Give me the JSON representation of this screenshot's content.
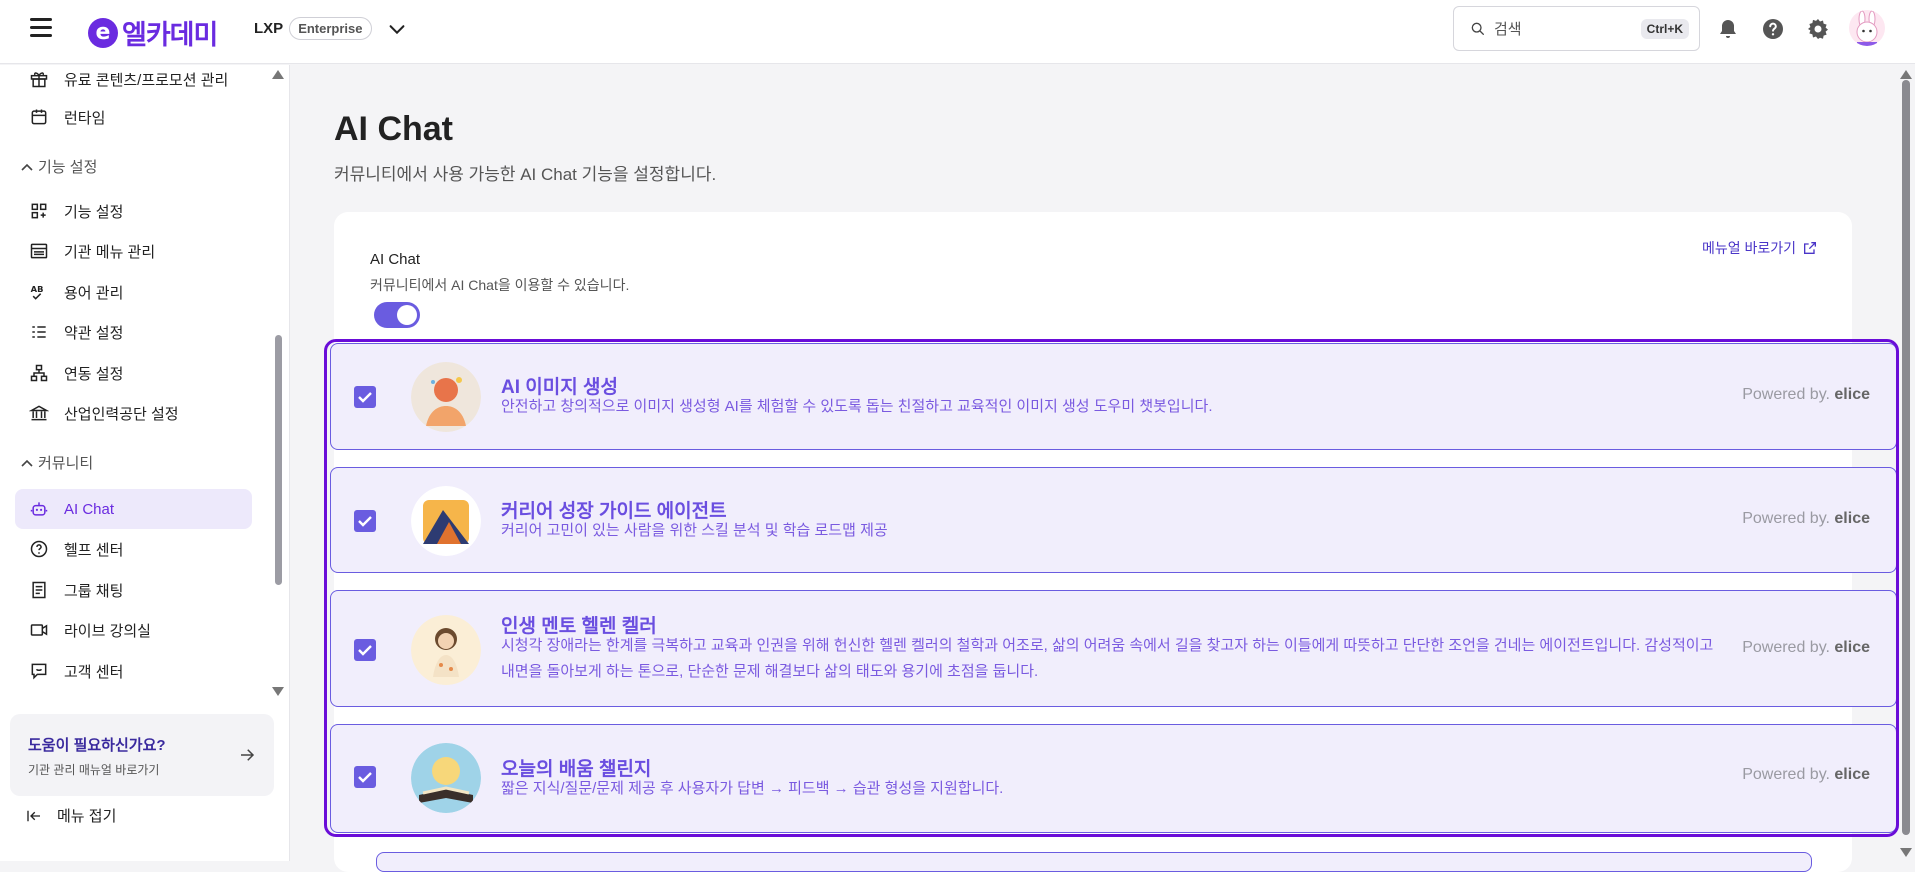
{
  "header": {
    "logo_text": "엘카데미",
    "product": "LXP",
    "edition": "Enterprise",
    "search_placeholder": "검색",
    "search_shortcut": "Ctrl+K"
  },
  "sidebar": {
    "items_top": [
      {
        "label": "유료 콘텐츠/프로모션 관리",
        "icon": "gift-icon"
      },
      {
        "label": "런타임",
        "icon": "calendar-icon"
      }
    ],
    "section_features": "기능 설정",
    "features_items": [
      {
        "label": "기능 설정",
        "icon": "grid-plus-icon"
      },
      {
        "label": "기관 메뉴 관리",
        "icon": "menu-panel-icon"
      },
      {
        "label": "용어 관리",
        "icon": "spellcheck-icon"
      },
      {
        "label": "약관 설정",
        "icon": "list-icon"
      },
      {
        "label": "연동 설정",
        "icon": "hierarchy-icon"
      },
      {
        "label": "산업인력공단 설정",
        "icon": "bank-icon"
      }
    ],
    "section_community": "커뮤니티",
    "community_items": [
      {
        "label": "AI Chat",
        "icon": "robot-icon"
      },
      {
        "label": "헬프 센터",
        "icon": "help-icon"
      },
      {
        "label": "그룹 채팅",
        "icon": "chat-doc-icon"
      },
      {
        "label": "라이브 강의실",
        "icon": "video-icon"
      },
      {
        "label": "고객 센터",
        "icon": "support-icon"
      }
    ],
    "help_title": "도움이 필요하신가요?",
    "help_sub": "기관 관리 매뉴얼 바로가기",
    "collapse_label": "메뉴 접기"
  },
  "main": {
    "title": "AI Chat",
    "description": "커뮤니티에서 사용 가능한 AI Chat 기능을 설정합니다.",
    "feature_label": "AI Chat",
    "feature_desc": "커뮤니티에서 AI Chat을 이용할 수 있습니다.",
    "toggle_on": true,
    "manual_link": "메뉴얼 바로가기",
    "powered_prefix": "Powered by.",
    "powered_brand": "elice",
    "bots": [
      {
        "name": "AI 이미지 생성",
        "desc": "안전하고 창의적으로 이미지 생성형 AI를 체험할 수 있도록 돕는 친절하고 교육적인 이미지 생성 도우미 챗봇입니다.",
        "checked": true
      },
      {
        "name": "커리어 성장 가이드 에이전트",
        "desc": "커리어 고민이 있는 사람을 위한 스킬 분석 및 학습 로드맵 제공",
        "checked": true
      },
      {
        "name": "인생 멘토 헬렌 켈러",
        "desc": "시청각 장애라는 한계를 극복하고 교육과 인권을 위해 헌신한 헬렌 켈러의 철학과 어조로, 삶의 어려움 속에서 길을 찾고자 하는 이들에게 따뜻하고 단단한 조언을 건네는 에이전트입니다. 감성적이고 내면을 돌아보게 하는 톤으로, 단순한 문제 해결보다 삶의 태도와 용기에 초점을 둡니다.",
        "checked": true
      },
      {
        "name": "오늘의 배움 챌린지",
        "desc": "짧은 지식/질문/문제 제공 후 사용자가 답변 → 피드백 → 습관 형성을 지원합니다.",
        "checked": true
      }
    ]
  }
}
